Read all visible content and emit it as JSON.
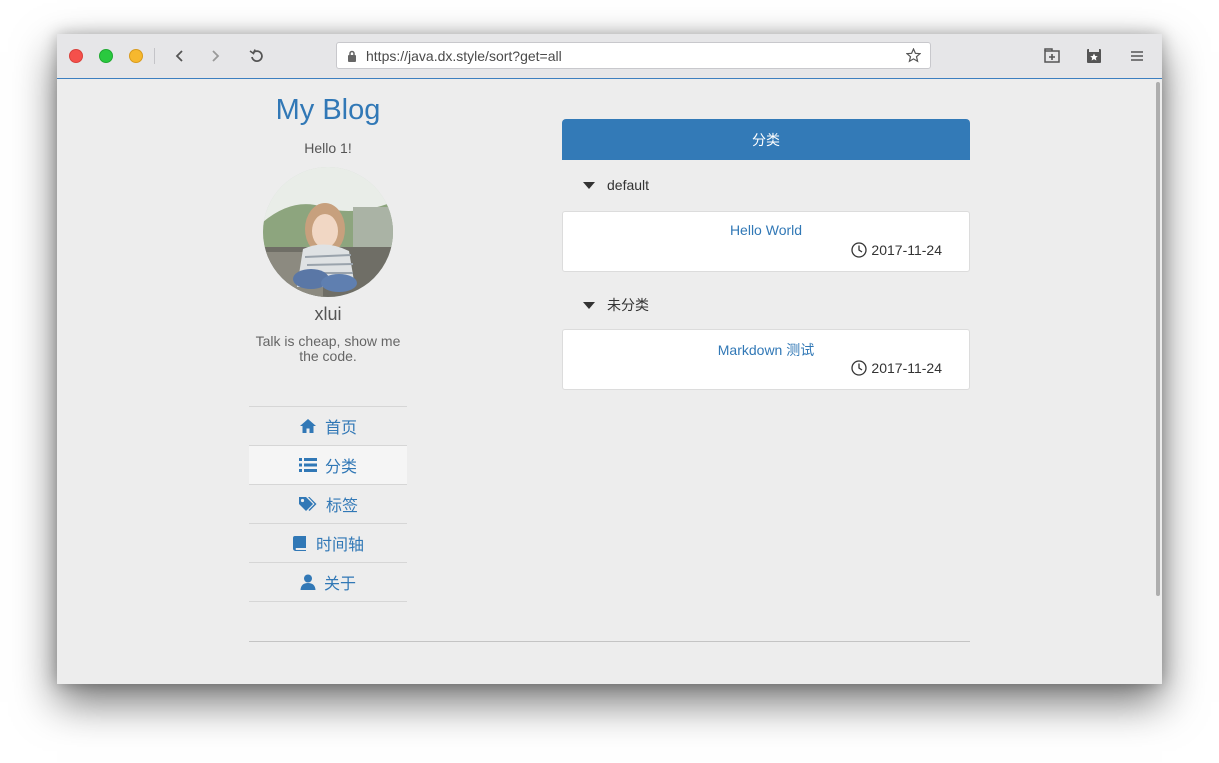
{
  "browser": {
    "url": "https://java.dx.style/sort?get=all"
  },
  "sidebar": {
    "blog_title": "My Blog",
    "greeting": "Hello 1!",
    "username": "xlui",
    "motto": "Talk is cheap, show me the code.",
    "nav": [
      {
        "label": "首页",
        "icon": "home-icon"
      },
      {
        "label": "分类",
        "icon": "list-icon",
        "active": true
      },
      {
        "label": "标签",
        "icon": "tags-icon"
      },
      {
        "label": "时间轴",
        "icon": "book-icon"
      },
      {
        "label": "关于",
        "icon": "user-icon"
      }
    ]
  },
  "main": {
    "panel_title": "分类",
    "groups": [
      {
        "name": "default",
        "posts": [
          {
            "title": "Hello World",
            "date": "2017-11-24"
          }
        ]
      },
      {
        "name": "未分类",
        "posts": [
          {
            "title": "Markdown 测试",
            "date": "2017-11-24"
          }
        ]
      }
    ]
  },
  "colors": {
    "accent": "#337ab7",
    "link": "#3178b6",
    "background": "#ededed"
  }
}
